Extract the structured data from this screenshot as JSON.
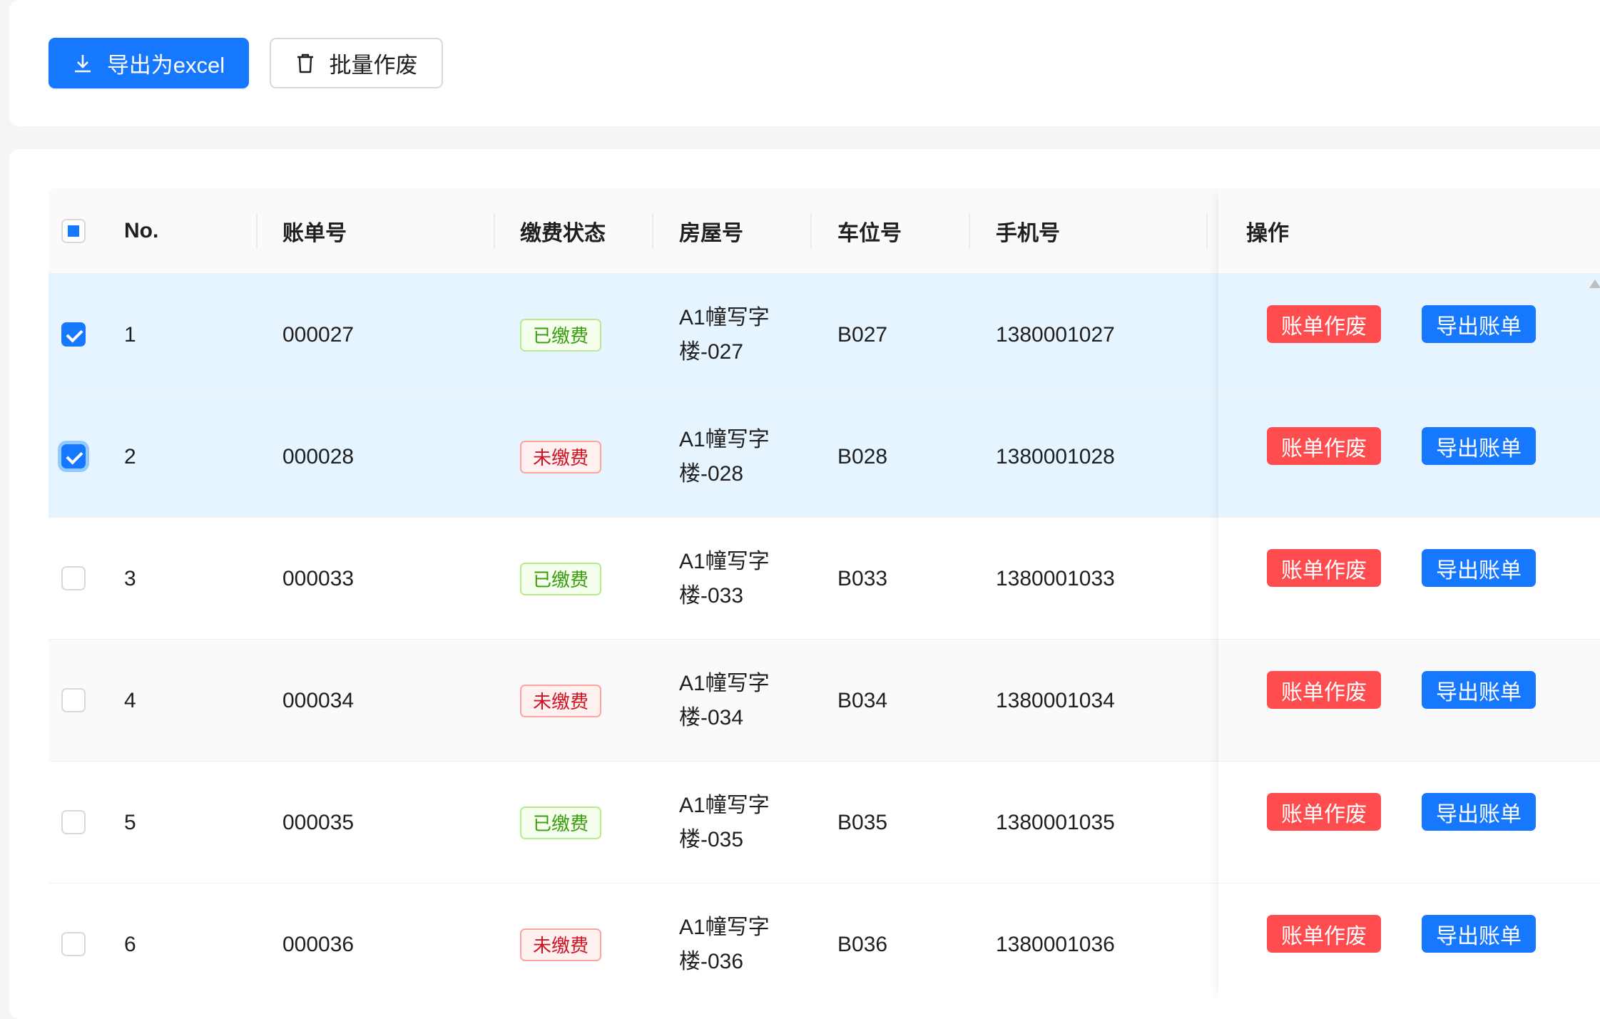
{
  "toolbar": {
    "export_label": "导出为excel",
    "batch_void_label": "批量作废"
  },
  "table": {
    "columns": {
      "no": "No.",
      "bill_no": "账单号",
      "status": "缴费状态",
      "house": "房屋号",
      "parking": "车位号",
      "phone": "手机号",
      "actions": "操作"
    },
    "action_labels": {
      "void": "账单作废",
      "export": "导出账单"
    },
    "rows": [
      {
        "no": "1",
        "bill_no": "000027",
        "status": "已缴费",
        "status_type": "paid",
        "house": "A1幢写字\n楼-027",
        "parking": "B027",
        "phone": "1380001027",
        "checked": true
      },
      {
        "no": "2",
        "bill_no": "000028",
        "status": "未缴费",
        "status_type": "unpaid",
        "house": "A1幢写字\n楼-028",
        "parking": "B028",
        "phone": "1380001028",
        "checked": true
      },
      {
        "no": "3",
        "bill_no": "000033",
        "status": "已缴费",
        "status_type": "paid",
        "house": "A1幢写字\n楼-033",
        "parking": "B033",
        "phone": "1380001033",
        "checked": false
      },
      {
        "no": "4",
        "bill_no": "000034",
        "status": "未缴费",
        "status_type": "unpaid",
        "house": "A1幢写字\n楼-034",
        "parking": "B034",
        "phone": "1380001034",
        "checked": false
      },
      {
        "no": "5",
        "bill_no": "000035",
        "status": "已缴费",
        "status_type": "paid",
        "house": "A1幢写字\n楼-035",
        "parking": "B035",
        "phone": "1380001035",
        "checked": false
      },
      {
        "no": "6",
        "bill_no": "000036",
        "status": "未缴费",
        "status_type": "unpaid",
        "house": "A1幢写字\n楼-036",
        "parking": "B036",
        "phone": "1380001036",
        "checked": false
      }
    ]
  },
  "colors": {
    "primary": "#1677ff",
    "danger": "#ff4d4f",
    "selected_row": "#e6f4ff"
  }
}
